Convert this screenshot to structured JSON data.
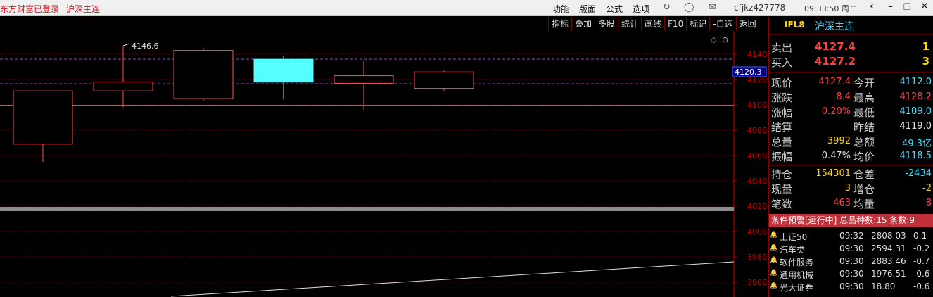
{
  "titlebar": {
    "login_status": "东方财富已登录",
    "market_name": "沪深主连",
    "menu": [
      "功能",
      "版面",
      "公式",
      "选项"
    ],
    "user": "cfjkz427778",
    "time": "09:33:50 周二"
  },
  "chart_toolbar": [
    "指标",
    "叠加",
    "多股",
    "统计",
    "画线",
    "F10",
    "标记",
    "-自选",
    "返回"
  ],
  "chart_data": {
    "type": "candlestick",
    "candles": [
      {
        "open": 4069,
        "close": 4111,
        "high": 4111,
        "low": 4055
      },
      {
        "open": 4111,
        "close": 4118,
        "high": 4146.6,
        "low": 4098
      },
      {
        "open": 4105,
        "close": 4143,
        "high": 4145,
        "low": 4103
      },
      {
        "open": 4136,
        "close": 4118,
        "high": 4139,
        "low": 4105
      },
      {
        "open": 4117,
        "close": 4123,
        "high": 4135,
        "low": 4096
      },
      {
        "open": 4113,
        "close": 4126,
        "high": 4127,
        "low": 4111
      }
    ],
    "high_label": "4146.6",
    "current_price_label": "4120.3",
    "yticks": [
      4140,
      4120,
      4100,
      4080,
      4060,
      4040,
      4020,
      4000,
      3980,
      3960
    ],
    "ylim": [
      3953,
      4173
    ]
  },
  "contract": {
    "code": "IFL8",
    "name": "沪深主连"
  },
  "quotes": [
    {
      "label": "卖出",
      "price": "4127.4",
      "qty": "1"
    },
    {
      "label": "买入",
      "price": "4127.2",
      "qty": "3"
    }
  ],
  "stats": [
    {
      "l1": "现价",
      "v1": "4127.4",
      "c1": "red",
      "l2": "今开",
      "v2": "4112.0",
      "c2": "cyan"
    },
    {
      "l1": "涨跌",
      "v1": "8.4",
      "c1": "red",
      "l2": "最高",
      "v2": "4128.2",
      "c2": "red"
    },
    {
      "l1": "涨幅",
      "v1": "0.20%",
      "c1": "red",
      "l2": "最低",
      "v2": "4109.0",
      "c2": "cyan"
    },
    {
      "l1": "结算",
      "v1": "",
      "c1": "white",
      "l2": "昨结",
      "v2": "4119.0",
      "c2": "white"
    },
    {
      "l1": "总量",
      "v1": "3992",
      "c1": "yellow",
      "l2": "总额",
      "v2": "49.3亿",
      "c2": "cyan"
    },
    {
      "l1": "振幅",
      "v1": "0.47%",
      "c1": "white",
      "l2": "均价",
      "v2": "4118.5",
      "c2": "cyan"
    }
  ],
  "stats2": [
    {
      "l1": "持仓",
      "v1": "154301",
      "c1": "yellow",
      "l2": "仓差",
      "v2": "-2434",
      "c2": "cyan"
    },
    {
      "l1": "现量",
      "v1": "3",
      "c1": "yellow",
      "l2": "增仓",
      "v2": "-2",
      "c2": "yellow"
    },
    {
      "l1": "笔数",
      "v1": "463",
      "c1": "red",
      "l2": "均量",
      "v2": "8",
      "c2": "red"
    }
  ],
  "alerts": {
    "header": "条件预警[运行中] 总品种数:15 条数:9",
    "rows": [
      {
        "name": "上证50",
        "time": "09:32",
        "price": "2808.03",
        "chg": "0.1",
        "bell": "red"
      },
      {
        "name": "汽车类",
        "time": "09:30",
        "price": "2594.31",
        "chg": "-0.2",
        "bell": "green"
      },
      {
        "name": "软件服务",
        "time": "09:30",
        "price": "2883.46",
        "chg": "-0.7",
        "bell": "green"
      },
      {
        "name": "通用机械",
        "time": "09:30",
        "price": "1976.51",
        "chg": "-0.6",
        "bell": "green"
      },
      {
        "name": "光大证券",
        "time": "09:30",
        "price": "18.80",
        "chg": "-0.6",
        "bell": "green"
      }
    ]
  },
  "colors": {
    "up": "#ff5050",
    "down": "#54ffff",
    "grid": "#7a0000",
    "axis": "#c00000"
  }
}
